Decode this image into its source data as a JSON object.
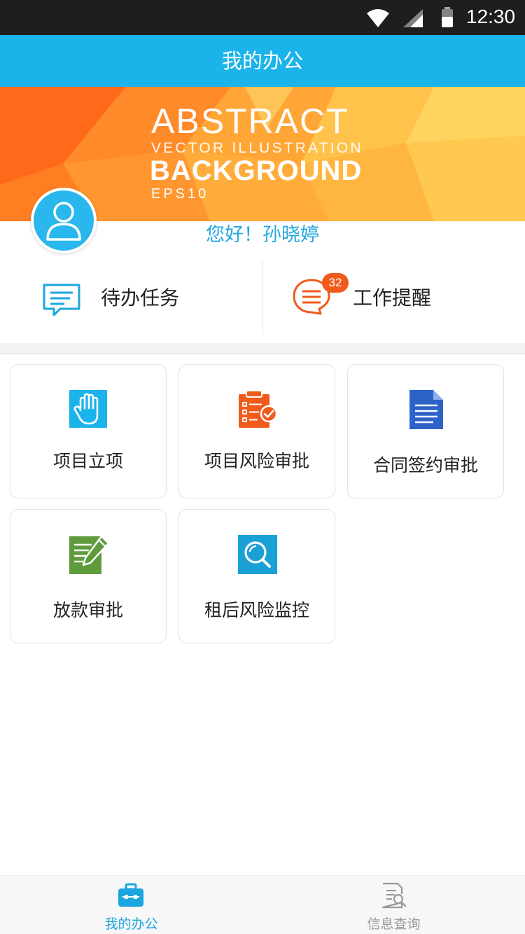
{
  "status_bar": {
    "time": "12:30",
    "icons": [
      "wifi-icon",
      "signal-icon",
      "battery-icon"
    ]
  },
  "title_bar": {
    "title": "我的办公"
  },
  "banner": {
    "line1": "ABSTRACT",
    "line2": "VECTOR ILLUSTRATION",
    "line3": "BACKGROUND",
    "line4": "EPS10"
  },
  "user": {
    "greeting": "您好！孙晓婷",
    "avatar_icon": "user-avatar-icon"
  },
  "tasks": {
    "todo": {
      "label": "待办任务",
      "icon": "message-icon"
    },
    "reminder": {
      "label": "工作提醒",
      "icon": "chat-lines-icon",
      "badge": "32"
    }
  },
  "modules": [
    {
      "label": "项目立项",
      "icon": "hand-icon"
    },
    {
      "label": "项目风险审批",
      "icon": "clipboard-check-icon"
    },
    {
      "label": "合同签约审批",
      "icon": "document-icon"
    },
    {
      "label": "放款审批",
      "icon": "edit-document-icon"
    },
    {
      "label": "租后风险监控",
      "icon": "search-icon"
    }
  ],
  "bottom_nav": [
    {
      "label": "我的办公",
      "icon": "briefcase-icon",
      "active": true
    },
    {
      "label": "信息查询",
      "icon": "document-search-icon",
      "active": false
    }
  ],
  "colors": {
    "primary": "#1bb4ea",
    "accent_orange": "#f05a1c",
    "nav_active": "#1ba6df",
    "nav_inactive": "#999999"
  }
}
